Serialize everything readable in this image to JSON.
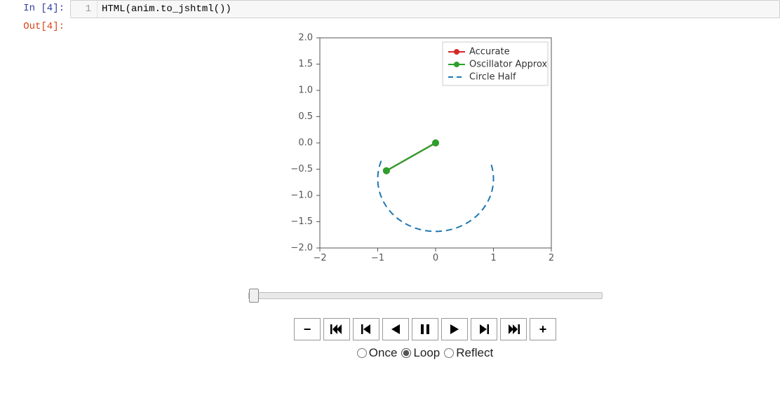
{
  "cell": {
    "in_prompt": "In  [4]:",
    "out_prompt": "Out[4]:",
    "gutter": "1",
    "code": "HTML(anim.to_jshtml())"
  },
  "chart_data": {
    "type": "line",
    "xlim": [
      -2,
      2
    ],
    "ylim": [
      -2,
      2
    ],
    "xticks": [
      -2,
      -1,
      0,
      1,
      2
    ],
    "yticks": [
      -2.0,
      -1.5,
      -1.0,
      -0.5,
      0.0,
      0.5,
      1.0,
      1.5,
      2.0
    ],
    "legend": {
      "items": [
        {
          "name": "Accurate",
          "marker": "circle",
          "color": "#d62728",
          "style": "solid"
        },
        {
          "name": "Oscillator Approx",
          "marker": "circle",
          "color": "#2ca02c",
          "style": "solid"
        },
        {
          "name": "Circle Half",
          "marker": null,
          "color": "#1f77b4",
          "style": "dashed"
        }
      ]
    },
    "series": [
      {
        "name": "Accurate",
        "x": [
          0,
          -0.85
        ],
        "y": [
          0.0,
          -0.53
        ],
        "color": "#d62728",
        "marker": true
      },
      {
        "name": "Oscillator Approx",
        "x": [
          0,
          -0.85
        ],
        "y": [
          0.0,
          -0.53
        ],
        "color": "#2ca02c",
        "marker": true
      }
    ],
    "circle_half": {
      "cx": 0,
      "cy": 0,
      "r": 1,
      "span_deg": [
        200,
        340
      ],
      "color": "#1f77b4"
    }
  },
  "controls": {
    "buttons": {
      "slower": "−",
      "first": "first-frame",
      "prev": "prev-frame",
      "back": "play-back",
      "pause": "pause",
      "play": "play",
      "next": "next-frame",
      "last": "last-frame",
      "faster": "+"
    },
    "modes": {
      "once": "Once",
      "loop": "Loop",
      "reflect": "Reflect",
      "selected": "loop"
    },
    "slider_value": 0
  }
}
